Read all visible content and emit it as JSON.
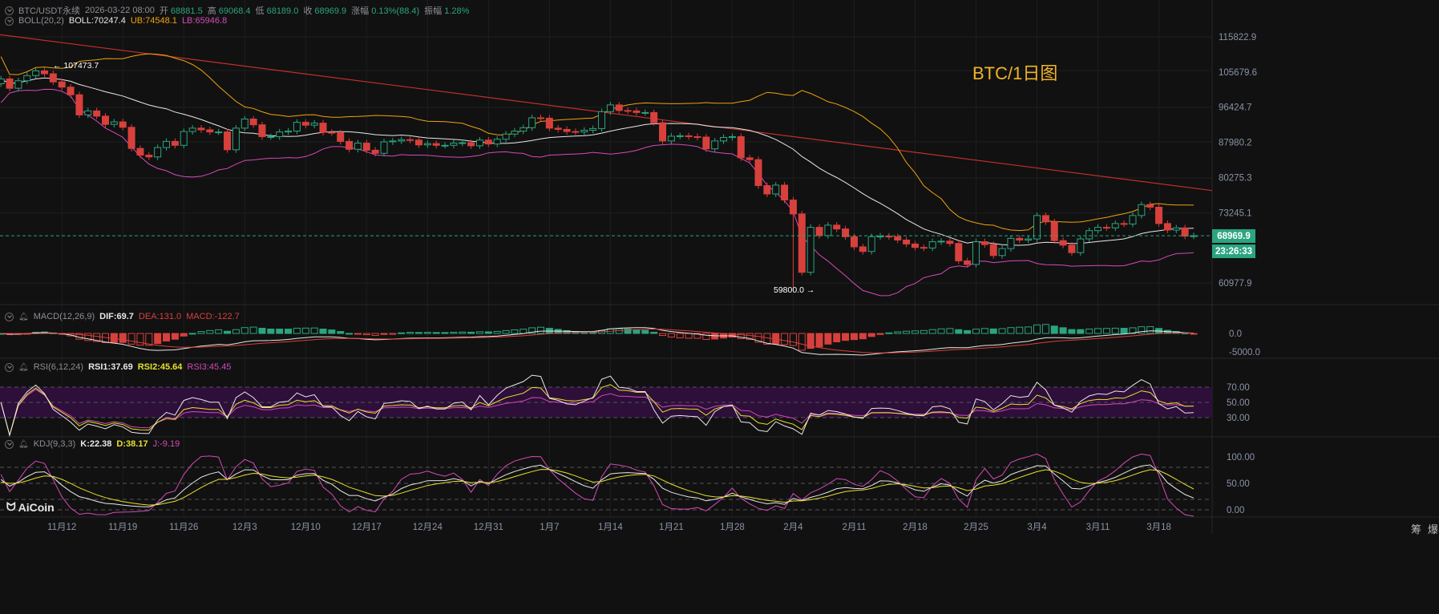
{
  "header": {
    "symbol": "BTC/USDT永续",
    "datetime": "2026-03-22 08:00",
    "open_label": "开",
    "open": "68881.5",
    "high_label": "高",
    "high": "69068.4",
    "low_label": "低",
    "low": "68189.0",
    "close_label": "收",
    "close": "68969.9",
    "change_label": "涨幅",
    "change": "0.13%(88.4)",
    "amp_label": "振幅",
    "amp": "1.28%"
  },
  "boll": {
    "name": "BOLL(20,2)",
    "mid": "BOLL:70247.4",
    "ub": "UB:74548.1",
    "lb": "LB:65946.8"
  },
  "macd": {
    "name": "MACD(12,26,9)",
    "dif": "DIF:69.7",
    "dea": "DEA:131.0",
    "macd": "MACD:-122.7"
  },
  "rsi": {
    "name": "RSI(6,12,24)",
    "rsi1": "RSI1:37.69",
    "rsi2": "RSI2:45.64",
    "rsi3": "RSI3:45.45"
  },
  "kdj": {
    "name": "KDJ(9,3,3)",
    "k": "K:22.38",
    "d": "D:38.17",
    "j": "J:-9.19"
  },
  "watermark_title": "BTC/1日图",
  "current_price": "68969.9",
  "countdown": "23:26:33",
  "annotations": {
    "high": "107473.7",
    "low": "59800.0"
  },
  "logo": "AiCoin",
  "corner_buttons": [
    "筹",
    "爆"
  ],
  "colors": {
    "up": "#2aa57f",
    "down": "#d8403c",
    "boll_mid": "#e8e8e8",
    "boll_ub": "#f0a30a",
    "boll_lb": "#d54ab9",
    "trendline": "#c0302c",
    "bg": "#111111"
  },
  "chart_data": {
    "type": "candlestick",
    "title": "BTC/USDT永续 1D",
    "price_axis_scale": "log",
    "price_axis_ticks": [
      "115822.9",
      "105679.6",
      "96424.7",
      "87980.2",
      "80275.3",
      "73245.1",
      "60977.9"
    ],
    "macd_axis_ticks": [
      "0.0",
      "-5000.0"
    ],
    "rsi_axis_ticks": [
      "70.00",
      "50.00",
      "30.00"
    ],
    "kdj_axis_ticks": [
      "100.00",
      "50.00",
      "0.00"
    ],
    "x_ticks": [
      {
        "label": "11月12",
        "day_index": 7
      },
      {
        "label": "11月19",
        "day_index": 14
      },
      {
        "label": "11月26",
        "day_index": 21
      },
      {
        "label": "12月3",
        "day_index": 28
      },
      {
        "label": "12月10",
        "day_index": 35
      },
      {
        "label": "12月17",
        "day_index": 42
      },
      {
        "label": "12月24",
        "day_index": 49
      },
      {
        "label": "12月31",
        "day_index": 56
      },
      {
        "label": "1月7",
        "day_index": 63
      },
      {
        "label": "1月14",
        "day_index": 70
      },
      {
        "label": "1月21",
        "day_index": 77
      },
      {
        "label": "1月28",
        "day_index": 84
      },
      {
        "label": "2月4",
        "day_index": 91
      },
      {
        "label": "2月11",
        "day_index": 98
      },
      {
        "label": "2月18",
        "day_index": 105
      },
      {
        "label": "2月25",
        "day_index": 112
      },
      {
        "label": "3月4",
        "day_index": 119
      },
      {
        "label": "3月11",
        "day_index": 126
      },
      {
        "label": "3月18",
        "day_index": 133
      }
    ],
    "first_day": "2025-11-05",
    "first_open": 102500,
    "closes": [
      103800,
      101300,
      103300,
      104700,
      106000,
      105200,
      103000,
      101600,
      99600,
      94500,
      95500,
      94200,
      92200,
      92800,
      91500,
      86600,
      85100,
      84700,
      86800,
      88200,
      87300,
      90500,
      91300,
      90900,
      90400,
      90400,
      86300,
      91300,
      93500,
      92100,
      89300,
      89300,
      90400,
      90600,
      92700,
      92000,
      92500,
      90300,
      90200,
      88200,
      86400,
      87800,
      86200,
      85500,
      88100,
      88300,
      88600,
      88500,
      87400,
      87700,
      87300,
      87300,
      87800,
      87900,
      87200,
      88500,
      87600,
      88700,
      89900,
      90600,
      91400,
      93800,
      93700,
      91300,
      91000,
      90500,
      90400,
      90800,
      91200,
      95300,
      97000,
      95600,
      95500,
      95100,
      95100,
      92600,
      88300,
      89400,
      89500,
      89300,
      89200,
      86500,
      88300,
      89100,
      89300,
      84500,
      84100,
      78600,
      76900,
      78700,
      75700,
      73000,
      62700,
      70500,
      69000,
      70900,
      70200,
      68800,
      67000,
      66200,
      68800,
      68900,
      68800,
      68200,
      67500,
      66900,
      66800,
      67900,
      68000,
      67600,
      64600,
      64000,
      67900,
      67400,
      65500,
      66700,
      68500,
      68200,
      68400,
      72700,
      71500,
      68100,
      67300,
      66000,
      68400,
      69900,
      70500,
      70400,
      71200,
      71100,
      72700,
      74800,
      74300,
      71200,
      70000,
      70400,
      68900,
      68969.9
    ],
    "marked_high": 107473.7,
    "marked_low": 59800.0,
    "marked_low_day_index": 92,
    "trendline": {
      "start_price": 116500,
      "end_price": 77600
    }
  }
}
